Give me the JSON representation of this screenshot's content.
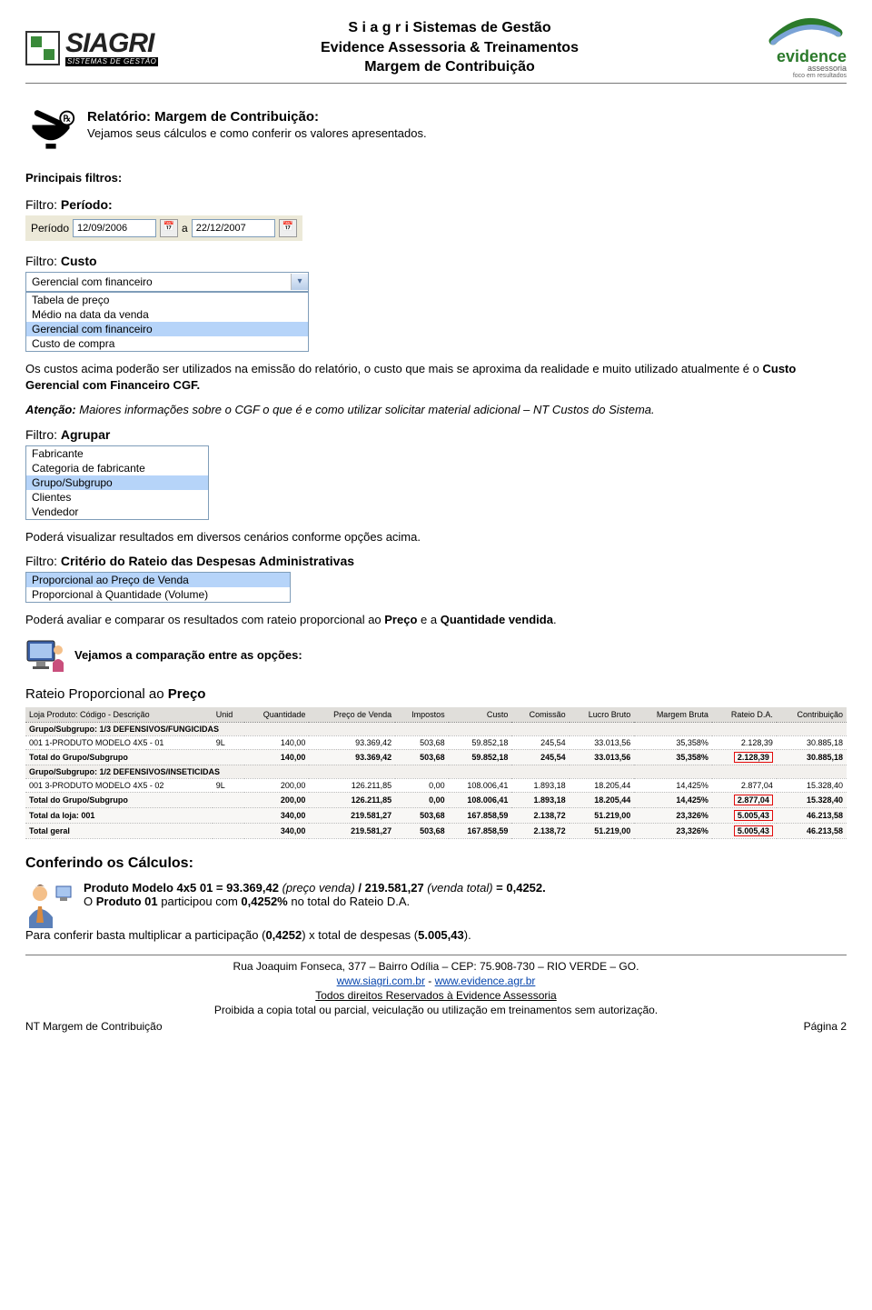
{
  "header": {
    "line1": "S i a g r i Sistemas de Gestão",
    "line2": "Evidence Assessoria & Treinamentos",
    "line3": "Margem de Contribuição",
    "siagri_brand": "SIAGRI",
    "siagri_tag": "SISTEMAS DE GESTÃO",
    "evidence_brand": "evidence",
    "evidence_sub": "assessoria",
    "evidence_tag": "foco em resultados"
  },
  "intro": {
    "title": "Relatório: Margem de Contribuição:",
    "subtitle": "Vejamos seus cálculos e como conferir os valores apresentados."
  },
  "filters": {
    "heading": "Principais filtros:",
    "periodo_label": "Filtro: ",
    "periodo_strong": "Período:",
    "periodo": {
      "label": "Período",
      "from": "12/09/2006",
      "sep": "a",
      "to": "22/12/2007"
    },
    "custo_label": "Filtro: ",
    "custo_strong": "Custo",
    "custo_selected": "Gerencial com financeiro",
    "custo_options": [
      "Tabela de preço",
      "Médio na data da venda",
      "Gerencial com financeiro",
      "Custo de compra"
    ],
    "custo_para": "Os custos acima poderão ser utilizados na emissão do relatório, o  custo que mais se aproxima da realidade e muito utilizado atualmente é o ",
    "custo_strong2": "Custo Gerencial com Financeiro CGF.",
    "atencao_bold": "Atenção:",
    "atencao_rest": " Maiores informações sobre o CGF o que é e como utilizar solicitar material adicional – NT Custos do Sistema.",
    "agrupar_label": "Filtro: ",
    "agrupar_strong": "Agrupar",
    "agrupar_options": [
      "Fabricante",
      "Categoria de fabricante",
      "Grupo/Subgrupo",
      "Clientes",
      "Vendedor"
    ],
    "agrupar_selected": "Grupo/Subgrupo",
    "agrupar_para": "Poderá visualizar resultados em diversos cenários conforme opções acima.",
    "criterio_label": "Filtro: ",
    "criterio_strong": "Critério do Rateio das Despesas Administrativas",
    "criterio_options": [
      "Proporcional ao Preço de Venda",
      "Proporcional à Quantidade (Volume)"
    ],
    "criterio_selected": "Proporcional ao Preço de Venda",
    "criterio_para_1": "Poderá avaliar e comparar os resultados com rateio proporcional ao ",
    "criterio_strong1": "Preço",
    "criterio_mid": " e a ",
    "criterio_strong2": "Quantidade vendida",
    "criterio_end": "."
  },
  "compare": {
    "callout": "Vejamos a comparação entre as opções:",
    "preco_title_1": "Rateio Proporcional ao ",
    "preco_title_2": "Preço"
  },
  "table": {
    "headers": [
      "Loja Produto: Código - Descrição",
      "Unid",
      "Quantidade",
      "Preço de Venda",
      "Impostos",
      "Custo",
      "Comissão",
      "Lucro Bruto",
      "Margem Bruta",
      "Rateio D.A.",
      "Contribuição"
    ],
    "groups": [
      {
        "label": "Grupo/Subgrupo: 1/3          DEFENSIVOS/FUNGICIDAS",
        "rows": [
          {
            "cells": [
              "001 1-PRODUTO MODELO 4X5 - 01",
              "9L",
              "140,00",
              "93.369,42",
              "503,68",
              "59.852,18",
              "245,54",
              "33.013,56",
              "35,358%",
              "2.128,39",
              "30.885,18"
            ]
          }
        ],
        "subtotal": {
          "label": "Total do Grupo/Subgrupo",
          "cells": [
            "",
            "140,00",
            "93.369,42",
            "503,68",
            "59.852,18",
            "245,54",
            "33.013,56",
            "35,358%",
            "2.128,39",
            "30.885,18"
          ]
        }
      },
      {
        "label": "Grupo/Subgrupo: 1/2          DEFENSIVOS/INSETICIDAS",
        "rows": [
          {
            "cells": [
              "001 3-PRODUTO MODELO 4X5 - 02",
              "9L",
              "200,00",
              "126.211,85",
              "0,00",
              "108.006,41",
              "1.893,18",
              "18.205,44",
              "14,425%",
              "2.877,04",
              "15.328,40"
            ]
          }
        ],
        "subtotal": {
          "label": "Total do Grupo/Subgrupo",
          "cells": [
            "",
            "200,00",
            "126.211,85",
            "0,00",
            "108.006,41",
            "1.893,18",
            "18.205,44",
            "14,425%",
            "2.877,04",
            "15.328,40"
          ]
        }
      }
    ],
    "total_loja": {
      "label": "Total da loja: 001",
      "cells": [
        "",
        "340,00",
        "219.581,27",
        "503,68",
        "167.858,59",
        "2.138,72",
        "51.219,00",
        "23,326%",
        "5.005,43",
        "46.213,58"
      ]
    },
    "total_geral": {
      "label": "Total geral",
      "cells": [
        "",
        "340,00",
        "219.581,27",
        "503,68",
        "167.858,59",
        "2.138,72",
        "51.219,00",
        "23,326%",
        "5.005,43",
        "46.213,58"
      ]
    }
  },
  "calc": {
    "heading": "Conferindo os Cálculos:",
    "line1_a": "Produto Modelo 4x5 01 = 93.369,42",
    "line1_i1": " (preço venda)",
    "line1_b": " / 219.581,27",
    "line1_i2": " (venda total)",
    "line1_c": " = 0,4252.",
    "line2_a": "O ",
    "line2_b": "Produto 01",
    "line2_c": " participou com ",
    "line2_d": "0,4252%",
    "line2_e": "  no total do Rateio D.A.",
    "line3_a": "Para conferir basta multiplicar a participação (",
    "line3_b": "0,4252",
    "line3_c": ") x total de despesas (",
    "line3_d": "5.005,43",
    "line3_e": ")."
  },
  "footer": {
    "addr": "Rua Joaquim Fonseca, 377 – Bairro Odília – CEP: 75.908-730 – RIO VERDE – GO.",
    "url1": "www.siagri.com.br",
    "url_sep": " - ",
    "url2": "www.evidence.agr.br",
    "rights": "Todos direitos Reservados à Evidence Assessoria",
    "warn": "Proibida a copia total ou parcial, veiculação ou utilização em treinamentos sem autorização.",
    "doc": "NT Margem de Contribuição",
    "page": "Página 2"
  }
}
